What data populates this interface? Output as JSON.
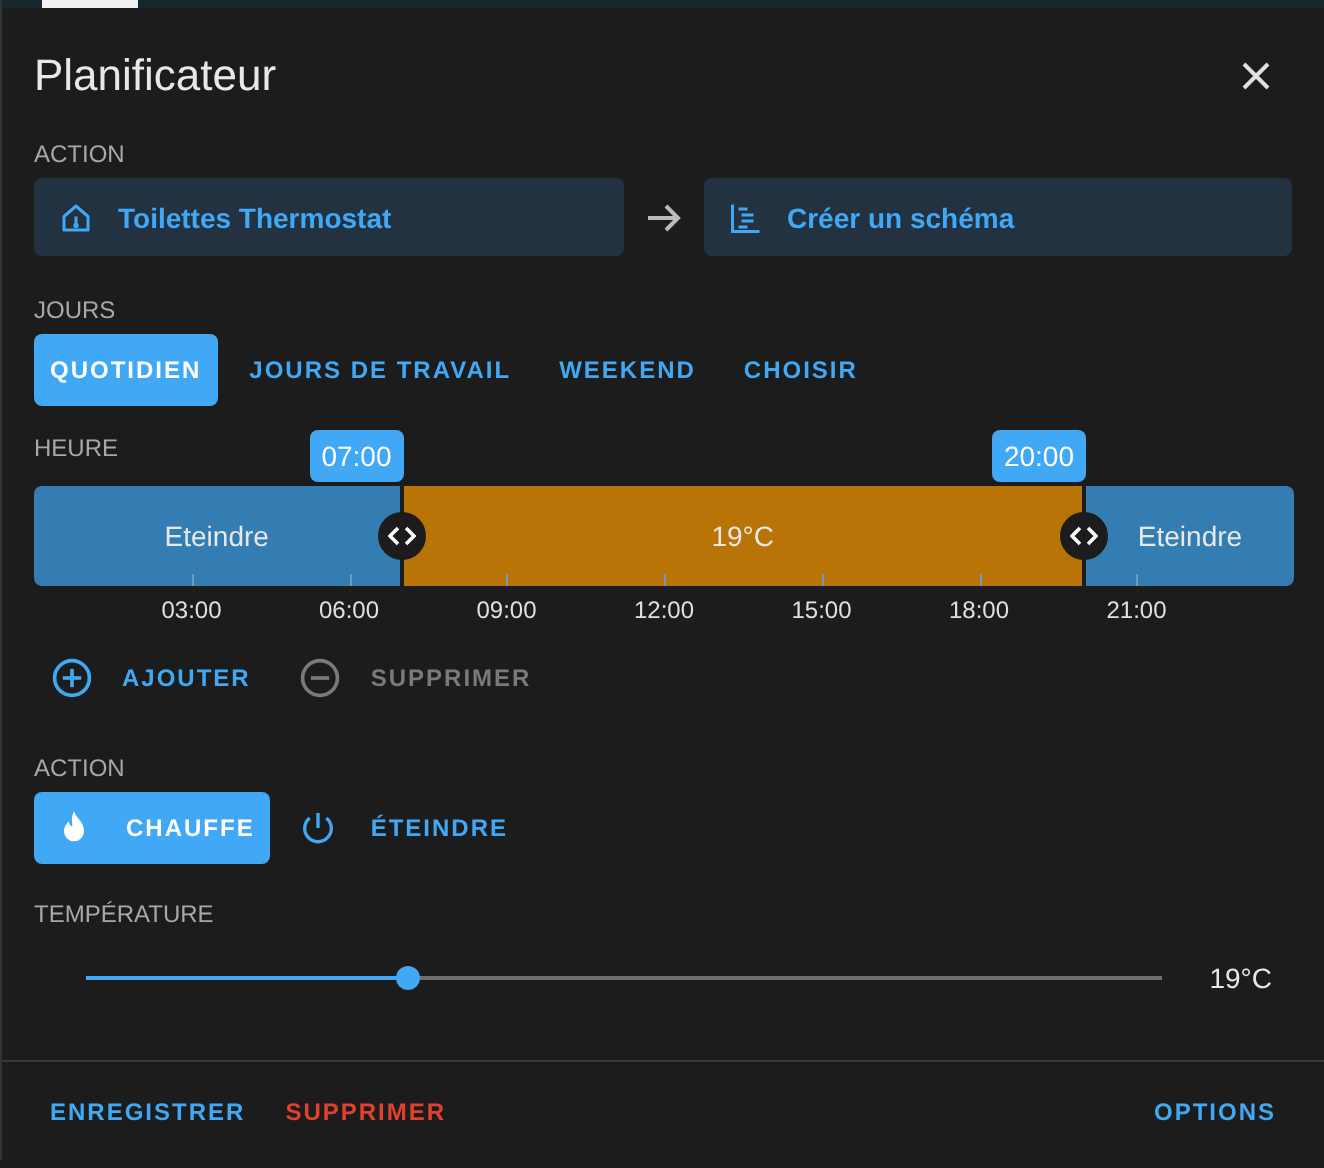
{
  "dialog": {
    "title": "Planificateur"
  },
  "action_section": {
    "label": "ACTION",
    "entity": "Toilettes Thermostat",
    "service": "Créer un schéma"
  },
  "days": {
    "label": "JOURS",
    "options": [
      {
        "label": "QUOTIDIEN",
        "selected": true
      },
      {
        "label": "JOURS DE TRAVAIL",
        "selected": false
      },
      {
        "label": "WEEKEND",
        "selected": false
      },
      {
        "label": "CHOISIR",
        "selected": false
      }
    ]
  },
  "timeline": {
    "label": "HEURE",
    "markers": [
      "07:00",
      "20:00"
    ],
    "segments": [
      {
        "label": "Eteindre",
        "kind": "off"
      },
      {
        "label": "19°C",
        "kind": "heat"
      },
      {
        "label": "Eteindre",
        "kind": "off"
      }
    ],
    "ticks": [
      "03:00",
      "06:00",
      "09:00",
      "12:00",
      "15:00",
      "18:00",
      "21:00"
    ]
  },
  "slot_buttons": [
    {
      "label": "AJOUTER",
      "kind": "add",
      "disabled": false
    },
    {
      "label": "SUPPRIMER",
      "kind": "remove",
      "disabled": true
    }
  ],
  "slot_action": {
    "label": "ACTION",
    "options": [
      {
        "label": "CHAUFFE",
        "kind": "heat",
        "selected": true
      },
      {
        "label": "ÉTEINDRE",
        "kind": "off",
        "selected": false
      }
    ]
  },
  "temperature": {
    "label": "TEMPÉRATURE",
    "level": 0.3,
    "reading": "19°C"
  },
  "footer": {
    "buttons": [
      {
        "label": "ENREGISTRER",
        "kind": "primary"
      },
      {
        "label": "SUPPRIMER",
        "kind": "danger"
      },
      {
        "label": "OPTIONS",
        "kind": "primary"
      }
    ]
  }
}
